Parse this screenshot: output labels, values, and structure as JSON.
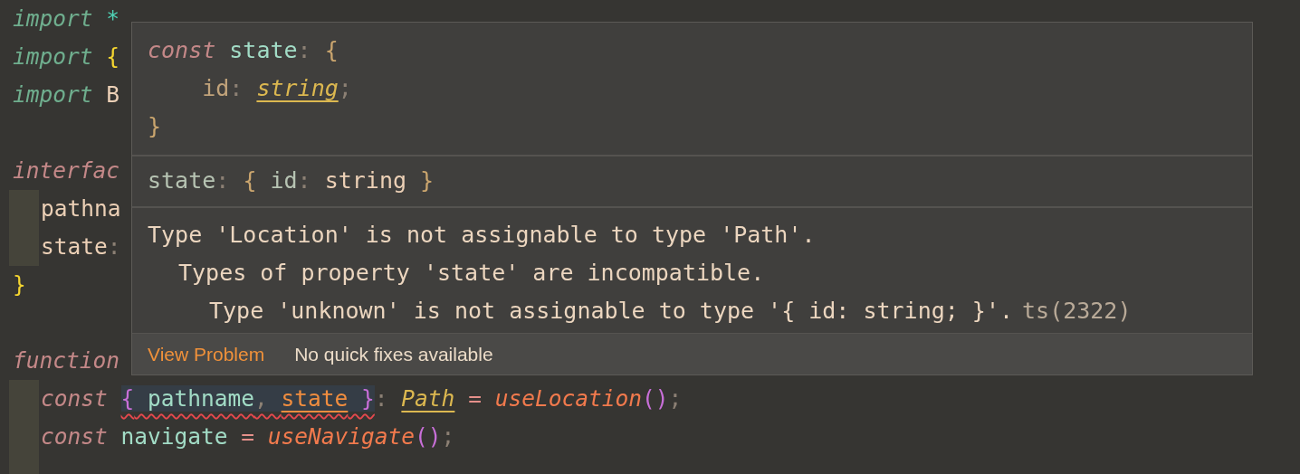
{
  "editor": {
    "lines": [
      {
        "indent_guide": false,
        "tokens": [
          {
            "kind": "import",
            "text": "import"
          },
          {
            "kind": "star",
            "text": " *"
          }
        ]
      },
      {
        "indent_guide": false,
        "tokens": [
          {
            "kind": "import",
            "text": "import"
          },
          {
            "kind": "bracket",
            "text": " {"
          }
        ]
      },
      {
        "indent_guide": false,
        "tokens": [
          {
            "kind": "import",
            "text": "import"
          },
          {
            "kind": "ident",
            "text": " B"
          }
        ]
      },
      {
        "indent_guide": false
      },
      {
        "indent_guide": false,
        "tokens": [
          {
            "kind": "keyword",
            "text": "interfac"
          }
        ]
      },
      {
        "indent_guide": true,
        "tokens": [
          {
            "kind": "ident",
            "text": "pathna"
          }
        ]
      },
      {
        "indent_guide": true,
        "tokens": [
          {
            "kind": "ident",
            "text": "state"
          },
          {
            "kind": "punct",
            "text": ":"
          }
        ]
      },
      {
        "indent_guide": false,
        "tokens": [
          {
            "kind": "bracket",
            "text": "}"
          }
        ]
      },
      {
        "indent_guide": false
      },
      {
        "indent_guide": false,
        "tokens": [
          {
            "kind": "keyword",
            "text": "function"
          }
        ]
      },
      {
        "indent_guide": true,
        "tokens": [
          {
            "kind": "keyword",
            "text": "const "
          },
          {
            "kind": "error_range",
            "tokens": [
              {
                "kind": "bracket2",
                "text": "{"
              },
              {
                "kind": "var",
                "text": " pathname"
              },
              {
                "kind": "punct",
                "text": ", "
              },
              {
                "kind": "ref",
                "text": "state"
              },
              {
                "kind": "bracket2",
                "text": " }"
              }
            ]
          },
          {
            "kind": "punct",
            "text": ": "
          },
          {
            "kind": "type_ref",
            "text": "Path"
          },
          {
            "kind": "op",
            "text": " = "
          },
          {
            "kind": "call",
            "text": "useLocation"
          },
          {
            "kind": "bracket2",
            "text": "()"
          },
          {
            "kind": "punct",
            "text": ";"
          }
        ]
      },
      {
        "indent_guide": true,
        "tokens": [
          {
            "kind": "keyword",
            "text": "const"
          },
          {
            "kind": "var",
            "text": " navigate"
          },
          {
            "kind": "op",
            "text": " = "
          },
          {
            "kind": "call",
            "text": "useNavigate"
          },
          {
            "kind": "bracket2",
            "text": "()"
          },
          {
            "kind": "punct",
            "text": ";"
          }
        ]
      },
      {
        "indent_guide": true
      }
    ]
  },
  "hover_popup": {
    "declaration": [
      [
        {
          "kind": "keyword",
          "text": "const"
        },
        {
          "kind": "var",
          "text": " state"
        },
        {
          "kind": "punct",
          "text": ": "
        },
        {
          "kind": "brace",
          "text": "{"
        }
      ],
      [
        {
          "kind": "prop",
          "text": "    id"
        },
        {
          "kind": "punct",
          "text": ": "
        },
        {
          "kind": "type_ref",
          "text": "string"
        },
        {
          "kind": "punct",
          "text": ";"
        }
      ],
      [
        {
          "kind": "brace",
          "text": "}"
        }
      ]
    ],
    "signature": [
      {
        "kind": "sig",
        "text": "state"
      },
      {
        "kind": "punct",
        "text": ": "
      },
      {
        "kind": "brace",
        "text": "{"
      },
      {
        "kind": "sig",
        "text": " id"
      },
      {
        "kind": "punct",
        "text": ": "
      },
      {
        "kind": "ident",
        "text": "string"
      },
      {
        "kind": "brace",
        "text": " }"
      }
    ],
    "message": {
      "text": "Type 'Location' is not assignable to type 'Path'.",
      "children": [
        {
          "text": "Types of property 'state' are incompatible.",
          "children": [
            {
              "text": "Type 'unknown' is not assignable to type '{ id: string; }'.",
              "code": "ts(2322)"
            }
          ]
        }
      ]
    },
    "footer": {
      "link": "View Problem",
      "note": "No quick fixes available"
    }
  }
}
